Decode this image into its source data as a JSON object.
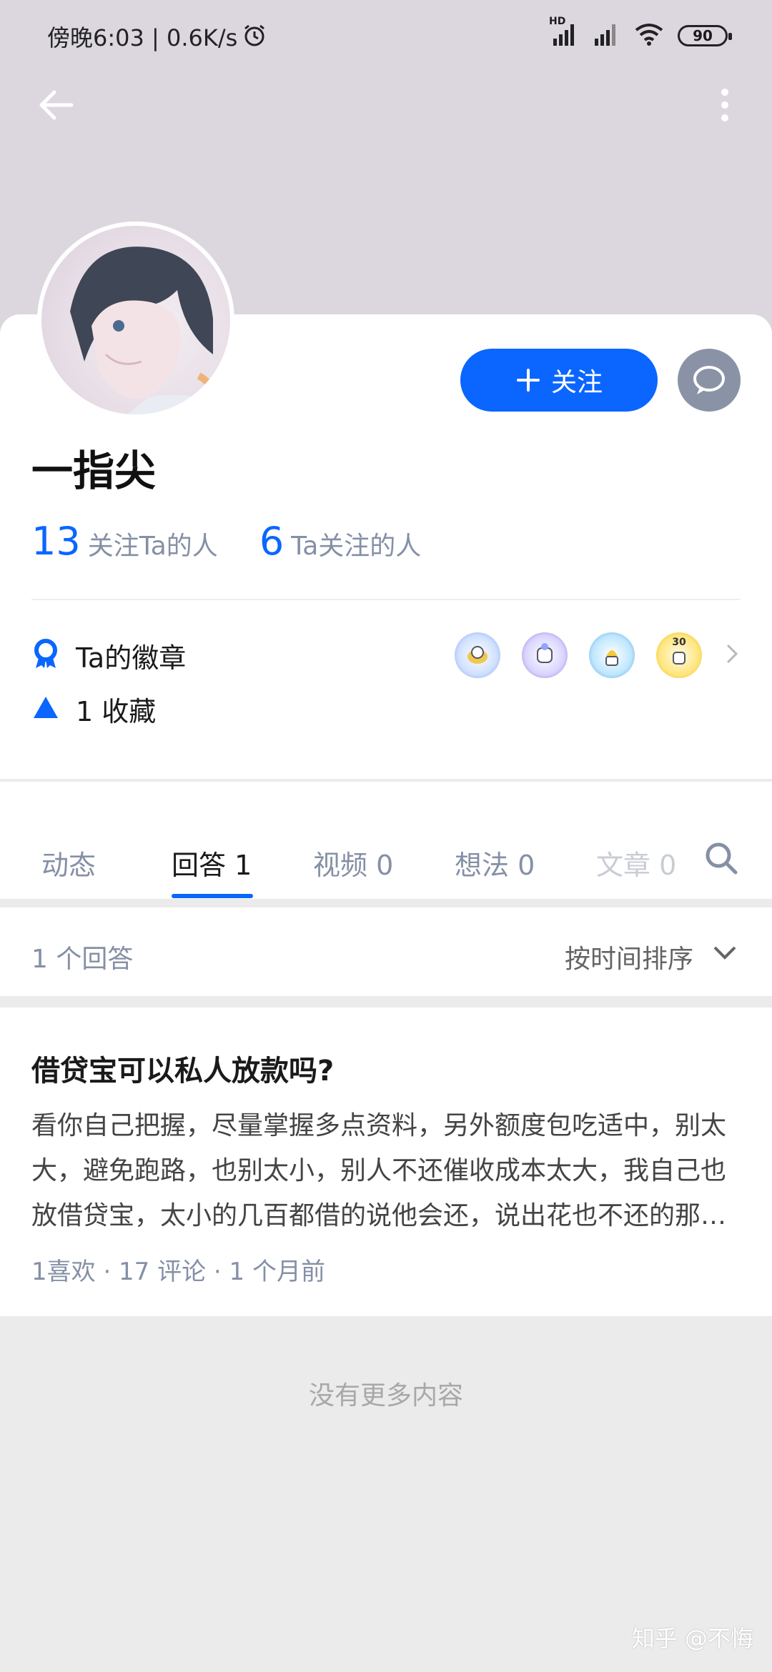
{
  "status_bar": {
    "time_speed": "傍晚6:03 | 0.6K/s",
    "battery": "90",
    "network_label": "HD"
  },
  "profile": {
    "name": "一指尖",
    "follow_label": "关注",
    "followers_count": "13",
    "followers_label": "关注Ta的人",
    "following_count": "6",
    "following_label": "Ta关注的人",
    "badges_label": "Ta的徽章",
    "badge_icons": [
      "badge-icon-1",
      "badge-icon-2",
      "badge-icon-3",
      "badge-icon-4"
    ],
    "badge4_text": "30",
    "collect_label": "1 收藏"
  },
  "tabs": [
    {
      "label": "动态"
    },
    {
      "label": "回答 1"
    },
    {
      "label": "视频 0"
    },
    {
      "label": "想法 0"
    },
    {
      "label": "文章 0"
    }
  ],
  "active_tab": "回答 1",
  "answers": {
    "count_label": "1 个回答",
    "sort_label": "按时间排序"
  },
  "answer_item": {
    "title": "借贷宝可以私人放款吗?",
    "excerpt": "看你自己把握，尽量掌握多点资料，另外额度包吃适中，别太大，避免跑路，也别太小，别人不还催收成本太大，我自己也放借贷宝，太小的几百都借的说他会还，说出花也不还的那种不要借",
    "meta": "1喜欢 · 17 评论 · 1 个月前"
  },
  "footer": {
    "no_more": "没有更多内容",
    "watermark": "知乎 @不悔"
  },
  "colors": {
    "accent": "#0a66ff",
    "header_bg": "#dcd7df",
    "muted": "#8590a6"
  }
}
